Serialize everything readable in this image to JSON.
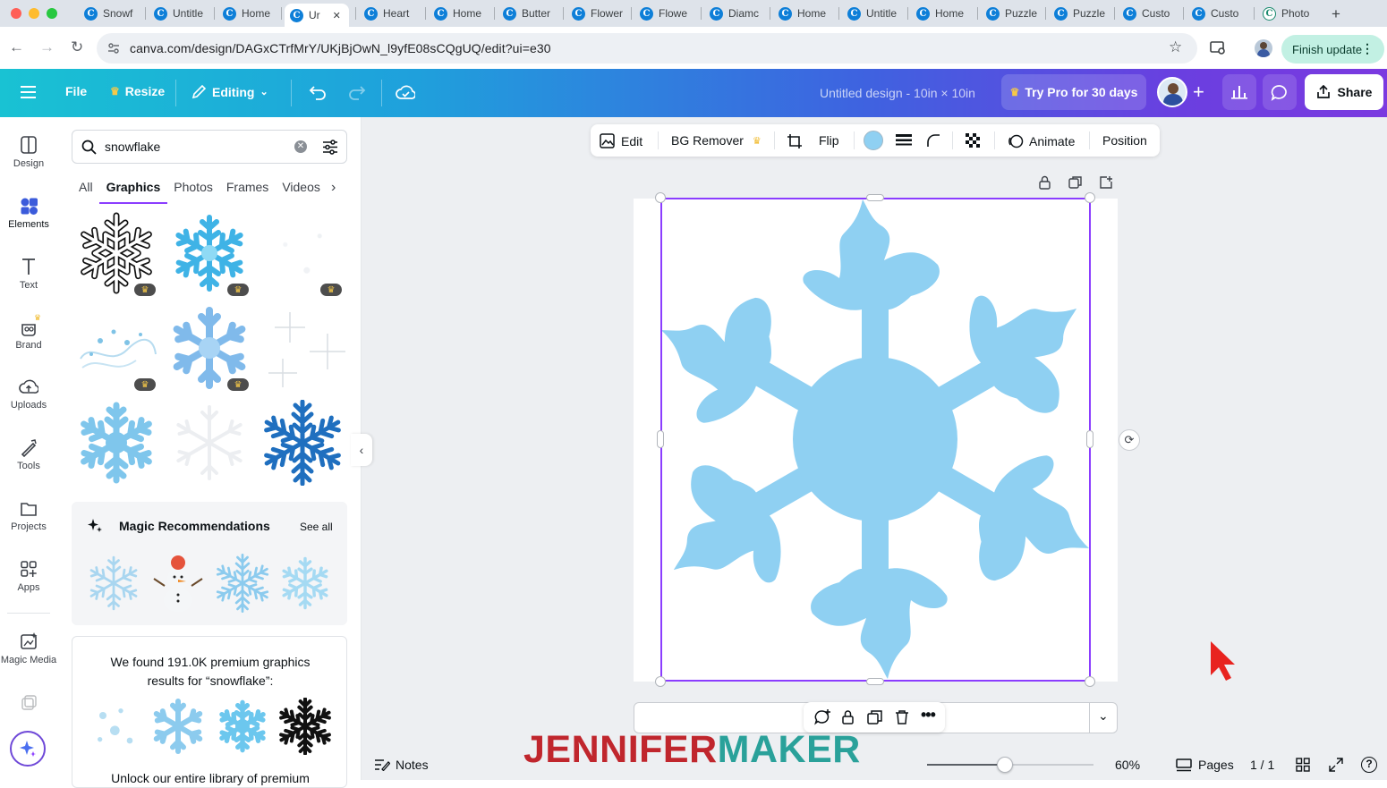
{
  "browser": {
    "tabs": [
      {
        "label": "Snowf",
        "active": false
      },
      {
        "label": "Untitle",
        "active": false
      },
      {
        "label": "Home",
        "active": false
      },
      {
        "label": "Ur",
        "active": true
      },
      {
        "label": "Heart",
        "active": false
      },
      {
        "label": "Home",
        "active": false
      },
      {
        "label": "Butter",
        "active": false
      },
      {
        "label": "Flower",
        "active": false
      },
      {
        "label": "Flowe",
        "active": false
      },
      {
        "label": "Diamc",
        "active": false
      },
      {
        "label": "Home",
        "active": false
      },
      {
        "label": "Untitle",
        "active": false
      },
      {
        "label": "Home",
        "active": false
      },
      {
        "label": "Puzzle",
        "active": false
      },
      {
        "label": "Puzzle",
        "active": false
      },
      {
        "label": "Custo",
        "active": false
      },
      {
        "label": "Custo",
        "active": false
      },
      {
        "label": "Photo",
        "active": false
      }
    ],
    "url": "canva.com/design/DAGxCTrfMrY/UKjBjOwN_l9yfE08sCQgUQ/edit?ui=e30",
    "finish_update": "Finish update"
  },
  "appbar": {
    "file": "File",
    "resize": "Resize",
    "editing": "Editing",
    "design_title": "Untitled design - 10in × 10in",
    "try_pro": "Try Pro for 30 days",
    "share": "Share"
  },
  "rail": [
    {
      "label": "Design",
      "icon": "design-icon"
    },
    {
      "label": "Elements",
      "icon": "elements-icon"
    },
    {
      "label": "Text",
      "icon": "text-icon"
    },
    {
      "label": "Brand",
      "icon": "brand-icon"
    },
    {
      "label": "Uploads",
      "icon": "uploads-icon"
    },
    {
      "label": "Tools",
      "icon": "tools-icon"
    },
    {
      "label": "Projects",
      "icon": "projects-icon"
    },
    {
      "label": "Apps",
      "icon": "apps-icon"
    },
    {
      "label": "Magic Media",
      "icon": "magic-media-icon"
    }
  ],
  "panel": {
    "search_value": "snowflake",
    "filter_tabs": [
      "All",
      "Graphics",
      "Photos",
      "Frames",
      "Videos"
    ],
    "active_filter": "Graphics",
    "magic_title": "Magic Recommendations",
    "see_all": "See all",
    "premium_line1": "We found 191.0K premium graphics",
    "premium_line2": "results for “snowflake”:",
    "premium_cut": "Unlock our entire library of premium"
  },
  "context_toolbar": {
    "edit": "Edit",
    "bg_remover": "BG Remover",
    "flip": "Flip",
    "animate": "Animate",
    "position": "Position",
    "fill_color": "#8fd0f2"
  },
  "bottom": {
    "notes": "Notes",
    "zoom": "60%",
    "pages": "Pages",
    "page_count": "1 / 1"
  },
  "watermark": {
    "part1": "JENNIFER",
    "part2": "MAKER"
  },
  "colors": {
    "snowflake": "#8fd0f2",
    "selection": "#8b3dff",
    "watermark_red": "#c0262d",
    "watermark_teal": "#2aa19a"
  }
}
